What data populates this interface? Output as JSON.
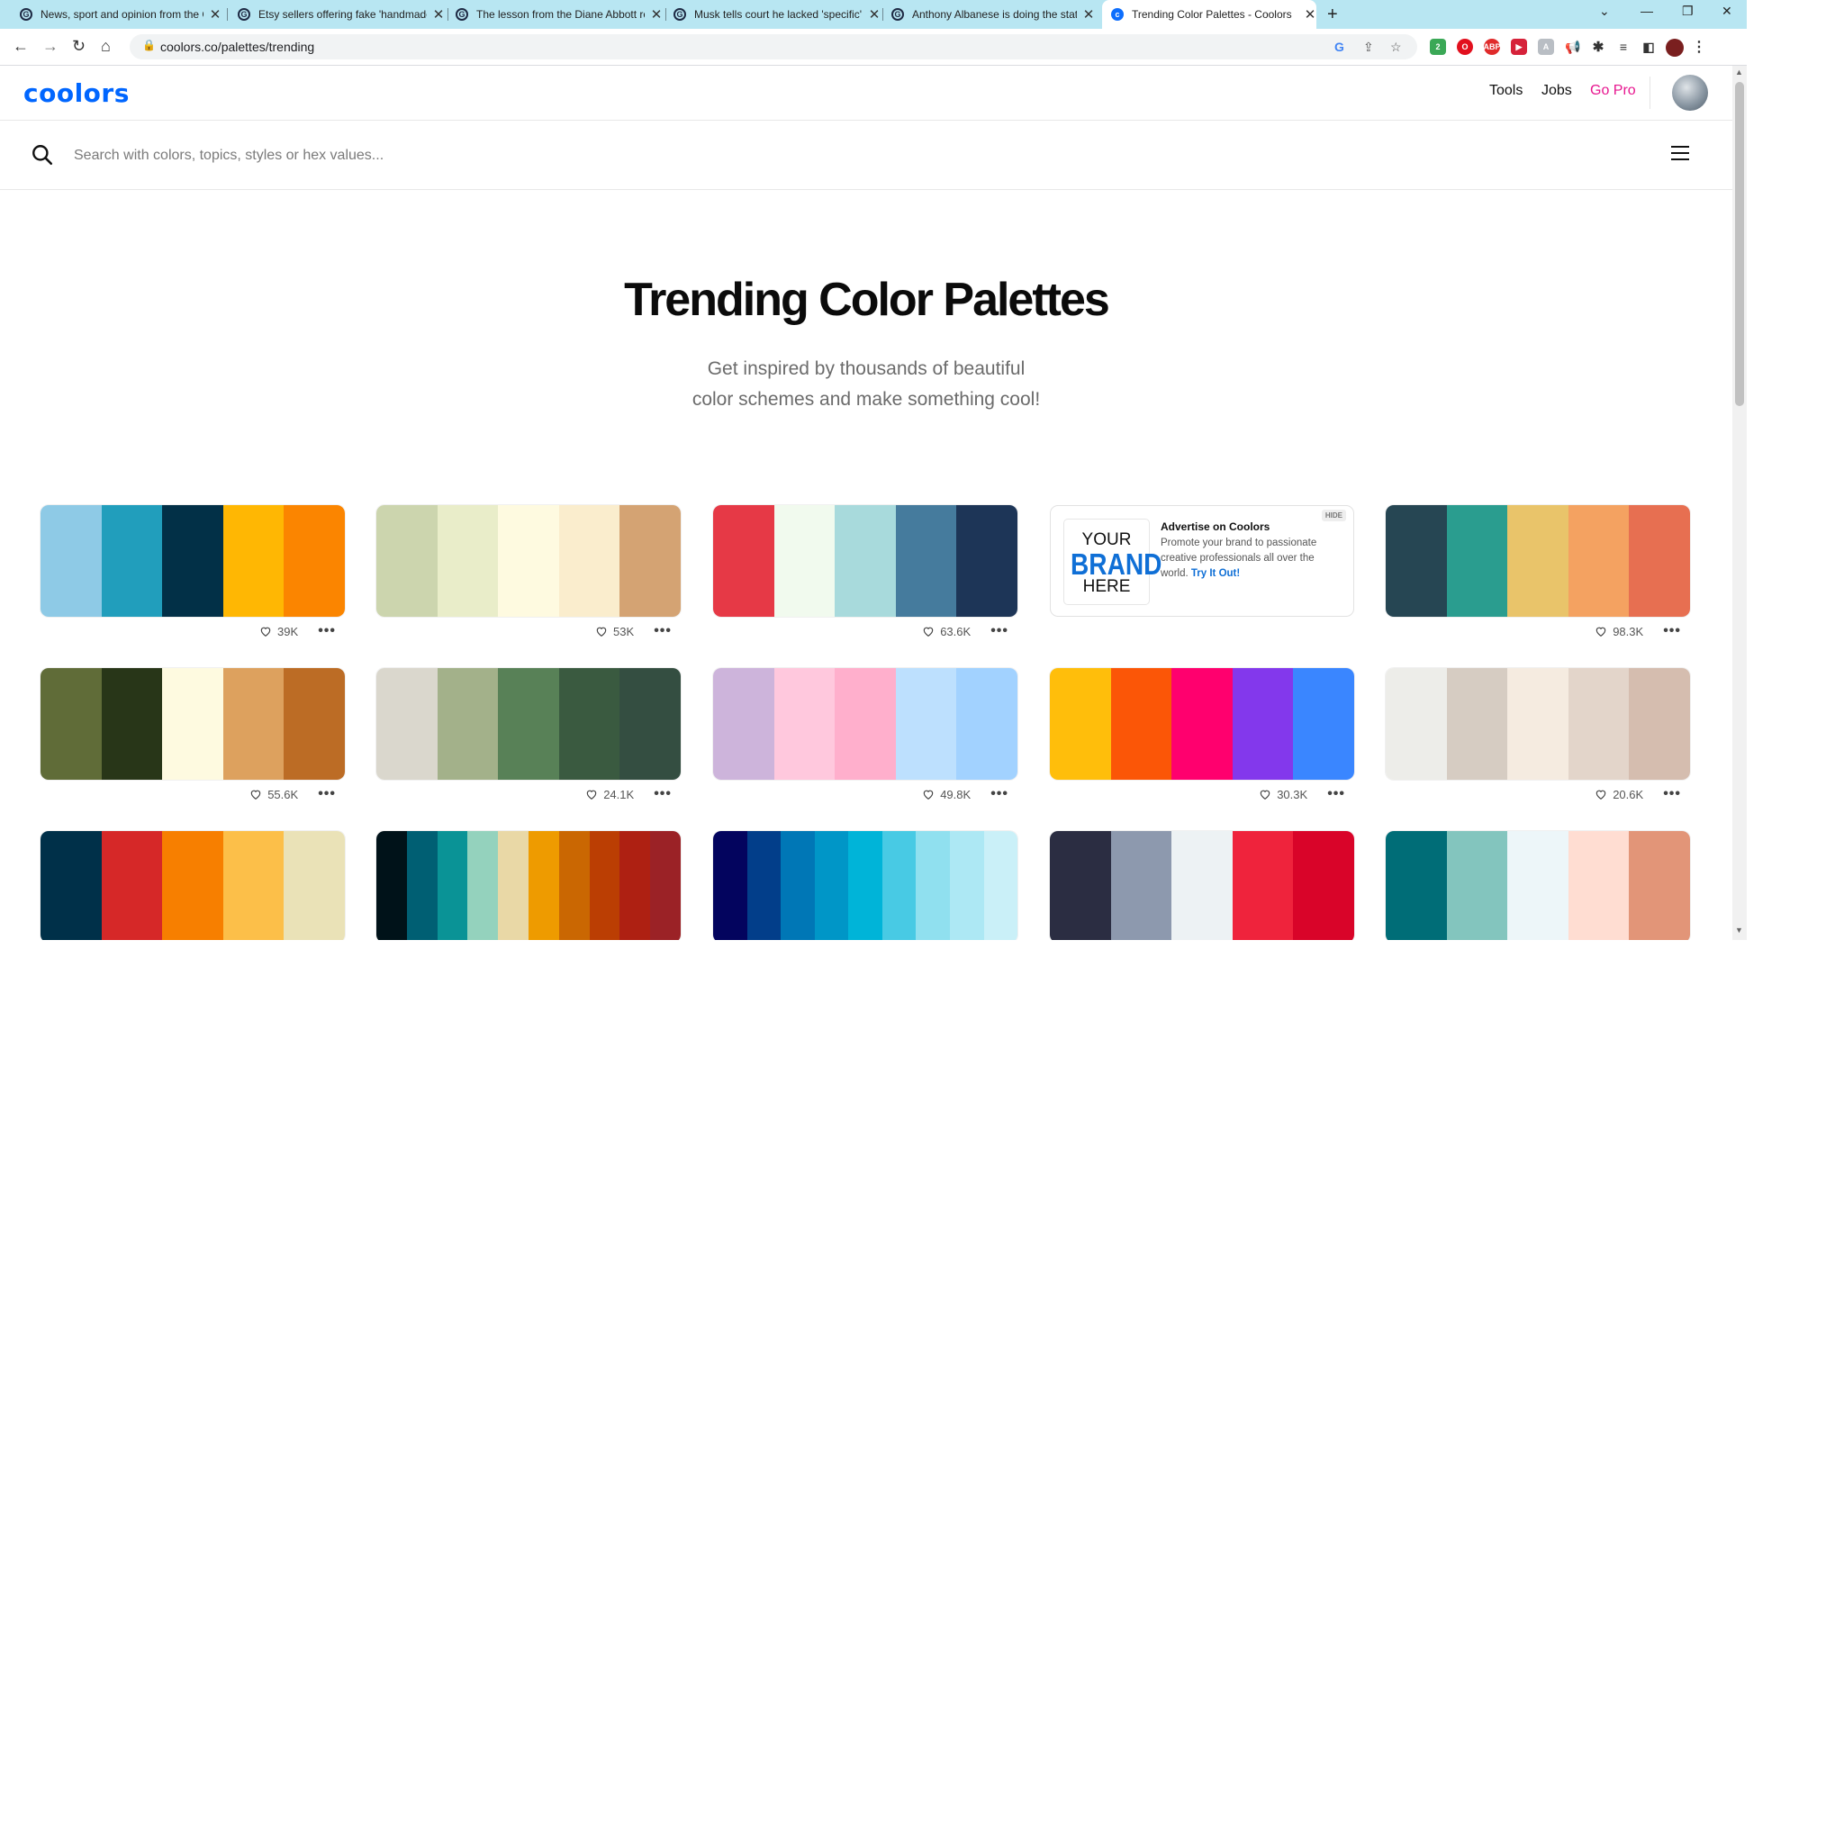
{
  "browser": {
    "tabs": [
      {
        "title": "News, sport and opinion from the Guardian's Australia edition",
        "favicon": "guardian-icon",
        "active": false
      },
      {
        "title": "Etsy sellers offering fake 'handmade' goods",
        "favicon": "guardian-icon",
        "active": false
      },
      {
        "title": "The lesson from the Diane Abbott row",
        "favicon": "guardian-icon",
        "active": false
      },
      {
        "title": "Musk tells court he lacked 'specific' knowledge",
        "favicon": "guardian-icon",
        "active": false
      },
      {
        "title": "Anthony Albanese is doing the state visit",
        "favicon": "guardian-icon",
        "active": false
      },
      {
        "title": "Trending Color Palettes - Coolors",
        "favicon": "coolors-icon",
        "active": true
      }
    ],
    "url": "coolors.co/palettes/trending"
  },
  "site": {
    "logo": "coolors",
    "nav": {
      "tools": "Tools",
      "jobs": "Jobs",
      "go_pro": "Go Pro"
    },
    "search_placeholder": "Search with colors, topics, styles or hex values..."
  },
  "hero": {
    "title": "Trending Color Palettes",
    "subtitle_line1": "Get inspired by thousands of beautiful",
    "subtitle_line2": "color schemes and make something cool!"
  },
  "ad": {
    "brand_line1": "YOUR",
    "brand_line2": "BRAND",
    "brand_line3": "HERE",
    "title": "Advertise on Coolors",
    "text": "Promote your brand to passionate creative professionals all over the world.",
    "link": "Try It Out!",
    "hide": "HIDE"
  },
  "palettes": [
    {
      "colors": [
        "#8ecae6",
        "#219ebc",
        "#023047",
        "#ffb703",
        "#fb8500"
      ],
      "likes": "39K"
    },
    {
      "colors": [
        "#ccd5ae",
        "#e9edc9",
        "#fefae0",
        "#faedcd",
        "#d4a373"
      ],
      "likes": "53K"
    },
    {
      "colors": [
        "#e63946",
        "#f1faee",
        "#a8dadc",
        "#457b9d",
        "#1d3557"
      ],
      "likes": "63.6K"
    },
    {
      "colors": [
        "#264653",
        "#2a9d8f",
        "#e9c46a",
        "#f4a261",
        "#e76f51"
      ],
      "likes": "98.3K"
    },
    {
      "colors": [
        "#606c38",
        "#283618",
        "#fefae0",
        "#dda15e",
        "#bc6c25"
      ],
      "likes": "55.6K"
    },
    {
      "colors": [
        "#dad7cd",
        "#a3b18a",
        "#588157",
        "#3a5a40",
        "#344e41"
      ],
      "likes": "24.1K"
    },
    {
      "colors": [
        "#cdb4db",
        "#ffc8dd",
        "#ffafcc",
        "#bde0fe",
        "#a2d2ff"
      ],
      "likes": "49.8K"
    },
    {
      "colors": [
        "#ffbe0b",
        "#fb5607",
        "#ff006e",
        "#8338ec",
        "#3a86ff"
      ],
      "likes": "30.3K"
    },
    {
      "colors": [
        "#edede9",
        "#d6ccc2",
        "#f5ebe0",
        "#e3d5ca",
        "#d5bdaf"
      ],
      "likes": "20.6K"
    },
    {
      "colors": [
        "#003049",
        "#d62828",
        "#f77f00",
        "#fcbf49",
        "#eae2b7"
      ],
      "likes": ""
    },
    {
      "colors": [
        "#001219",
        "#005f73",
        "#0a9396",
        "#94d2bd",
        "#e9d8a6",
        "#ee9b00",
        "#ca6702",
        "#bb3e03",
        "#ae2012",
        "#9b2226"
      ],
      "likes": ""
    },
    {
      "colors": [
        "#03045e",
        "#023e8a",
        "#0077b6",
        "#0096c7",
        "#00b4d8",
        "#48cae4",
        "#90e0ef",
        "#ade8f4",
        "#caf0f8"
      ],
      "likes": ""
    },
    {
      "colors": [
        "#2b2d42",
        "#8d99ae",
        "#edf2f4",
        "#ef233c",
        "#d90429"
      ],
      "likes": ""
    },
    {
      "colors": [
        "#006d77",
        "#83c5be",
        "#edf6f9",
        "#ffddd2",
        "#e29578"
      ],
      "likes": ""
    }
  ]
}
